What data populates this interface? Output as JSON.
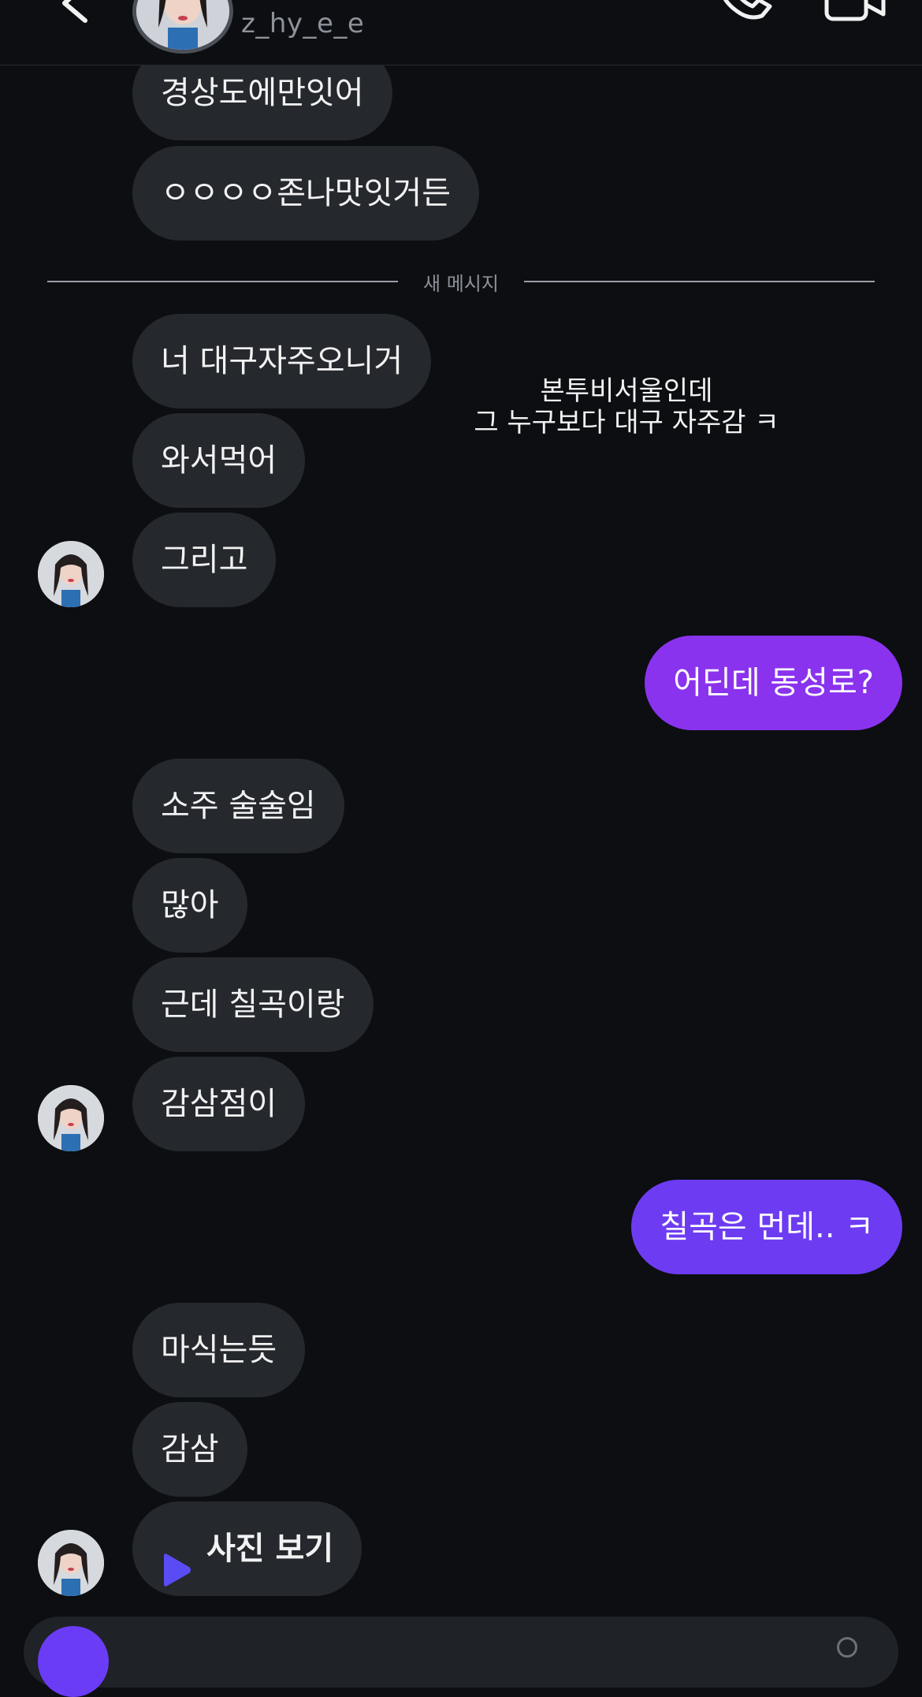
{
  "header": {
    "username": "z_hy_e_e"
  },
  "colors": {
    "background": "#0c0e12",
    "incoming_bubble": "#25282d",
    "outgoing_bubble_1": "#8a33ee",
    "outgoing_bubble_2": "#6d3cf2",
    "play_icon": "#5a4cf5"
  },
  "divider": {
    "label": "새 메시지"
  },
  "messages_top": [
    "경상도에만잇어",
    "ㅇㅇㅇㅇ존나맛잇거든"
  ],
  "group1": [
    "너 대구자주오니거",
    "와서먹어",
    "그리고"
  ],
  "floating_text": {
    "line1": "본투비서울인데",
    "line2": "그 누구보다 대구 자주감 ㅋ"
  },
  "outgoing1": "어딘데 동성로?",
  "group2": [
    "소주 술술임",
    "많아",
    "근데 칠곡이랑",
    "감삼점이"
  ],
  "outgoing2": "칠곡은 먼데.. ㅋ",
  "group3": [
    "마식는듯",
    "감삼"
  ],
  "photo_message": {
    "label": "사진 보기",
    "icon": "play-icon"
  },
  "icons": {
    "back": "chevron-left-icon",
    "call": "phone-icon",
    "video": "video-camera-icon",
    "camera": "camera-icon"
  }
}
